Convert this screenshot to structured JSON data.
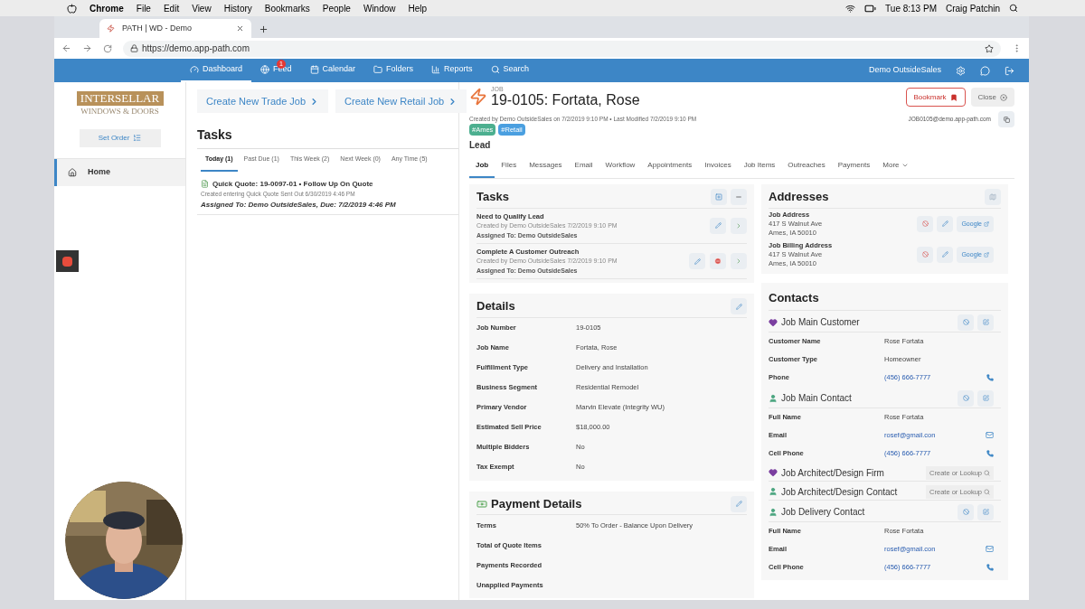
{
  "menubar": {
    "app": "Chrome",
    "menus": [
      "File",
      "Edit",
      "View",
      "History",
      "Bookmarks",
      "People",
      "Window",
      "Help"
    ],
    "clock": "Tue 8:13 PM",
    "user": "Craig Patchin"
  },
  "browser": {
    "tab_title": "PATH | WD - Demo",
    "url": "https://demo.app-path.com"
  },
  "nav": {
    "items": [
      {
        "label": "Dashboard",
        "selected": true
      },
      {
        "label": "Feed",
        "selected": false,
        "badge": "1"
      },
      {
        "label": "Calendar",
        "selected": false
      },
      {
        "label": "Folders",
        "selected": false
      },
      {
        "label": "Reports",
        "selected": false
      },
      {
        "label": "Search",
        "selected": false
      }
    ],
    "user": "Demo OutsideSales"
  },
  "sidebar": {
    "logo_line1": "INTERSELLAR",
    "logo_line2": "WINDOWS & DOORS",
    "set_order": "Set Order",
    "items": [
      {
        "label": "Home",
        "selected": true
      }
    ]
  },
  "dashboard": {
    "create_buttons": [
      "Create New Trade Job",
      "Create New Retail Job"
    ],
    "tasks_title": "Tasks",
    "tabs": [
      {
        "label": "Today (1)",
        "selected": true
      },
      {
        "label": "Past Due (1)",
        "selected": false
      },
      {
        "label": "This Week (2)",
        "selected": false
      },
      {
        "label": "Next Week (0)",
        "selected": false
      },
      {
        "label": "Any Time (5)",
        "selected": false
      }
    ],
    "tasks": [
      {
        "title": "Quick Quote: 19-0097-01 • Follow Up On Quote",
        "created": "Created entering Quick Quote Sent Out 6/30/2019 4:46 PM",
        "assigned": "Assigned To: Demo OutsideSales, Due: 7/2/2019 4:46 PM"
      }
    ]
  },
  "job": {
    "kind_label": "JOB",
    "title": "19-0105: Fortata, Rose",
    "meta": "Created by Demo OutsideSales on 7/2/2019 9:10 PM • Last Modified 7/2/2019 9:10 PM",
    "email": "JOB0105@demo.app-path.com",
    "tags": [
      {
        "label": "#Ames",
        "color": "#4caf8f"
      },
      {
        "label": "#Retail",
        "color": "#4a9fe0"
      }
    ],
    "status": "Lead",
    "bookmark": "Bookmark",
    "close": "Close",
    "tabs": [
      {
        "label": "Job",
        "selected": true
      },
      {
        "label": "Files",
        "selected": false
      },
      {
        "label": "Messages",
        "selected": false
      },
      {
        "label": "Email",
        "selected": false
      },
      {
        "label": "Workflow",
        "selected": false
      },
      {
        "label": "Appointments",
        "selected": false
      },
      {
        "label": "Invoices",
        "selected": false
      },
      {
        "label": "Job Items",
        "selected": false
      },
      {
        "label": "Outreaches",
        "selected": false
      },
      {
        "label": "Payments",
        "selected": false
      },
      {
        "label": "More",
        "selected": false
      }
    ]
  },
  "tasks_panel": {
    "title": "Tasks",
    "items": [
      {
        "title": "Need to Qualify Lead",
        "created": "Created by Demo OutsideSales 7/2/2019 9:10 PM",
        "assigned": "Assigned To: Demo OutsideSales",
        "cancelable": false
      },
      {
        "title": "Complete A Customer Outreach",
        "created": "Created by Demo OutsideSales 7/2/2019 9:10 PM",
        "assigned": "Assigned To: Demo OutsideSales",
        "cancelable": true
      }
    ]
  },
  "details": {
    "title": "Details",
    "rows": [
      {
        "label": "Job Number",
        "value": "19-0105"
      },
      {
        "label": "Job Name",
        "value": "Fortata, Rose"
      },
      {
        "label": "Fulfillment Type",
        "value": "Delivery and Installation"
      },
      {
        "label": "Business Segment",
        "value": "Residential Remodel"
      },
      {
        "label": "Primary Vendor",
        "value": "Marvin Elevate (Integrity WU)"
      },
      {
        "label": "Estimated Sell Price",
        "value": "$18,000.00"
      },
      {
        "label": "Multiple Bidders",
        "value": "No"
      },
      {
        "label": "Tax Exempt",
        "value": "No"
      }
    ]
  },
  "payment": {
    "title": "Payment Details",
    "rows": [
      {
        "label": "Terms",
        "value": "50% To Order - Balance Upon Delivery"
      },
      {
        "label": "Total of Quote Items"
      },
      {
        "label": "Payments Recorded"
      },
      {
        "label": "Unapplied Payments"
      }
    ]
  },
  "addresses": {
    "title": "Addresses",
    "items": [
      {
        "label": "Job Address",
        "line1": "417 S Walnut Ave",
        "line2": "Ames, IA 50010",
        "link": "Google"
      },
      {
        "label": "Job Billing Address",
        "line1": "417 S Walnut Ave",
        "line2": "Ames, IA 50010",
        "link": "Google"
      }
    ]
  },
  "contacts": {
    "title": "Contacts",
    "groups": [
      {
        "kind": "organization",
        "title": "Job Main Customer",
        "rows": [
          {
            "label": "Customer Name",
            "value": "Rose Fortata",
            "kind": "text"
          },
          {
            "label": "Customer Type",
            "value": "Homeowner",
            "kind": "text"
          },
          {
            "label": "Phone",
            "value": "(456) 666-7777",
            "kind": "phone"
          }
        ]
      },
      {
        "kind": "person",
        "title": "Job Main Contact",
        "rows": [
          {
            "label": "Full Name",
            "value": "Rose Fortata",
            "kind": "text"
          },
          {
            "label": "Email",
            "value": "rosef@gmail.con",
            "kind": "email"
          },
          {
            "label": "Cell Phone",
            "value": "(456) 666-7777",
            "kind": "phone"
          }
        ]
      },
      {
        "kind": "organization",
        "title": "Job Architect/Design Firm",
        "action": "Create or Lookup"
      },
      {
        "kind": "person",
        "title": "Job Architect/Design Contact",
        "action": "Create or Lookup"
      },
      {
        "kind": "person",
        "title": "Job Delivery Contact",
        "rows": [
          {
            "label": "Full Name",
            "value": "Rose Fortata",
            "kind": "text"
          },
          {
            "label": "Email",
            "value": "rosef@gmail.con",
            "kind": "email"
          },
          {
            "label": "Cell Phone",
            "value": "(456) 666-7777",
            "kind": "phone"
          }
        ]
      }
    ]
  }
}
